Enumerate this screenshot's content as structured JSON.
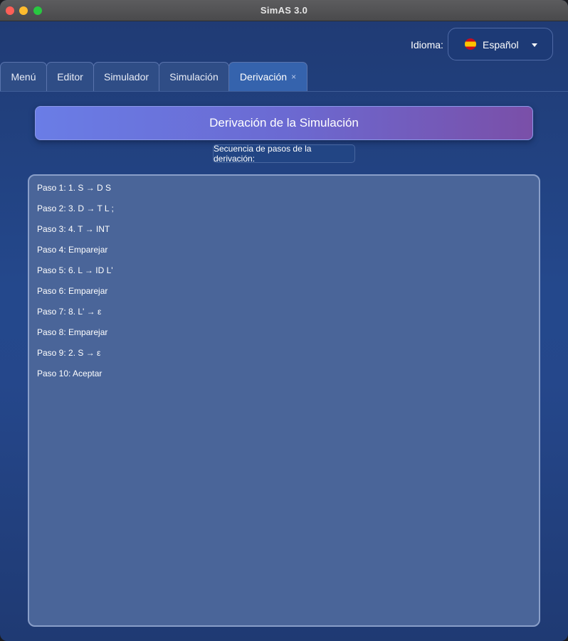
{
  "window": {
    "title": "SimAS 3.0"
  },
  "language": {
    "label": "Idioma:",
    "selected": "Español",
    "flag_icon": "spain-flag-icon"
  },
  "tabs": [
    {
      "label": "Menú"
    },
    {
      "label": "Editor"
    },
    {
      "label": "Simulador"
    },
    {
      "label": "Simulación"
    },
    {
      "label": "Derivación",
      "close": "×",
      "active": true
    }
  ],
  "main": {
    "title": "Derivación de la Simulación",
    "subtitle": "Secuencia de pasos de la derivación:",
    "steps": [
      "Paso 1: 1. S → D S",
      "Paso 2: 3. D → T L ;",
      "Paso 3: 4. T → INT",
      "Paso 4: Emparejar",
      "Paso 5: 6. L → ID L'",
      "Paso 6: Emparejar",
      "Paso 7: 8. L' → ε",
      "Paso 8: Emparejar",
      "Paso 9: 2. S → ε",
      "Paso 10: Aceptar"
    ]
  },
  "colors": {
    "banner_start": "#6a7de6",
    "banner_end": "#7a4fa8",
    "active_tab": "#3563ad",
    "panel_bg": "#4a6599"
  }
}
